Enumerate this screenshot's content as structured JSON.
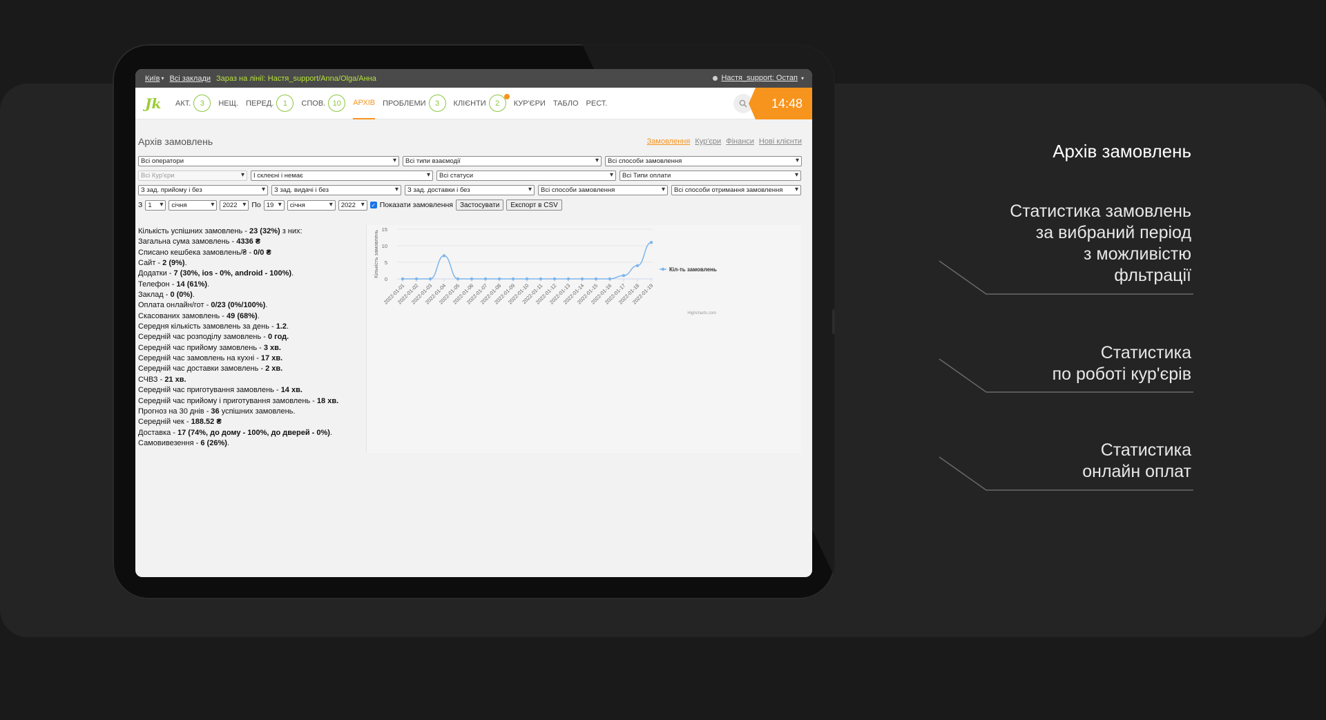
{
  "topbar": {
    "city": "Київ",
    "places": "Всі заклади",
    "online_label": "Зараз на лінії: Настя_support/Anna/Olga/Анна",
    "user": "Настя_support: Остап"
  },
  "nav": {
    "items": [
      {
        "label": "АКТ.",
        "badge": "3"
      },
      {
        "label": "НЕЩ.",
        "badge": ""
      },
      {
        "label": "ПЕРЕД.",
        "badge": "1"
      },
      {
        "label": "СПОВ.",
        "badge": "10"
      },
      {
        "label": "АРХІВ",
        "badge": ""
      },
      {
        "label": "ПРОБЛЕМИ",
        "badge": "3"
      },
      {
        "label": "КЛІЄНТИ",
        "badge": "2"
      },
      {
        "label": "КУР'ЄРИ",
        "badge": ""
      },
      {
        "label": "ТАБЛО",
        "badge": ""
      },
      {
        "label": "РЕСТ.",
        "badge": ""
      }
    ],
    "clock": "14:48",
    "logo": "Jk"
  },
  "page": {
    "title": "Архів замовлень",
    "subnav": [
      "Замовлення",
      "Кур'єри",
      "Фінанси",
      "Нові клієнти"
    ]
  },
  "filters": {
    "row1": [
      "Всі оператори",
      "Всі типи взаємодії",
      "Всі способи замовлення"
    ],
    "row2": [
      "Всі Кур'єри",
      "І склеєні і немає",
      "Всі статуси",
      "Всі Типи оплати"
    ],
    "row3": [
      "З зад. прийому і без",
      "З зад. видачі і без",
      "З зад. доставки і без",
      "Всі способи замовлення",
      "Всі способи отримання замовлення"
    ],
    "from_label": "З",
    "from_day": "1",
    "from_month": "січня",
    "from_year": "2022",
    "to_label": "По",
    "to_day": "19",
    "to_month": "січня",
    "to_year": "2022",
    "show_orders": "Показати замовлення",
    "apply": "Застосувати",
    "export": "Експорт в CSV"
  },
  "stats": [
    {
      "label": "Кількість успішних замовлень - ",
      "value": "23 (32%)",
      "suffix": " з них:"
    },
    {
      "label": "Загальна сума замовлень - ",
      "value": "4336 ₴",
      "suffix": ""
    },
    {
      "label": "Списано кешбека замовлень/₴ - ",
      "value": "0/0 ₴",
      "suffix": ""
    },
    {
      "label": "Сайт - ",
      "value": "2 (9%)",
      "suffix": "."
    },
    {
      "label": "Додатки - ",
      "value": "7 (30%, ios - 0%, android - 100%)",
      "suffix": "."
    },
    {
      "label": "Телефон - ",
      "value": "14 (61%)",
      "suffix": "."
    },
    {
      "label": "Заклад - ",
      "value": "0 (0%)",
      "suffix": "."
    },
    {
      "label": "Оплата онлайн/гот - ",
      "value": "0/23 (0%/100%)",
      "suffix": "."
    },
    {
      "label": "Скасованих замовлень - ",
      "value": "49 (68%)",
      "suffix": "."
    },
    {
      "label": "Середня кількість замовлень за день - ",
      "value": "1.2",
      "suffix": "."
    },
    {
      "label": "Середній час розподілу замовлень - ",
      "value": "0 год.",
      "suffix": ""
    },
    {
      "label": "Середній час прийому замовлень - ",
      "value": "3 хв.",
      "suffix": ""
    },
    {
      "label": "Середній час замовлень на кухні - ",
      "value": "17 хв.",
      "suffix": ""
    },
    {
      "label": "Середній час доставки замовлень - ",
      "value": "2 хв.",
      "suffix": ""
    },
    {
      "label": "СЧВЗ - ",
      "value": "21 хв.",
      "suffix": ""
    },
    {
      "label": "Середній час приготування замовлень - ",
      "value": "14 хв.",
      "suffix": ""
    },
    {
      "label": "Середній час прийому і приготування замовлень - ",
      "value": "18 хв.",
      "suffix": ""
    },
    {
      "label": "Прогноз на 30 днів - ",
      "value": "36",
      "suffix": " успішних замовлень."
    },
    {
      "label": "Середній чек - ",
      "value": "188.52 ₴",
      "suffix": ""
    },
    {
      "label": "Доставка - ",
      "value": "17 (74%, до дому - 100%, до дверей - 0%)",
      "suffix": "."
    },
    {
      "label": "Самовивезення - ",
      "value": "6 (26%)",
      "suffix": "."
    }
  ],
  "chart_data": {
    "type": "line",
    "ylabel": "Кількість замовлень",
    "ylim": [
      0,
      15
    ],
    "yticks": [
      0,
      5,
      10,
      15
    ],
    "x": [
      "2022-01-01",
      "2022-01-02",
      "2022-01-03",
      "2022-01-04",
      "2022-01-05",
      "2022-01-06",
      "2022-01-07",
      "2022-01-08",
      "2022-01-09",
      "2022-01-10",
      "2022-01-11",
      "2022-01-12",
      "2022-01-13",
      "2022-01-14",
      "2022-01-15",
      "2022-01-16",
      "2022-01-17",
      "2022-01-18",
      "2022-01-19"
    ],
    "series": [
      {
        "name": "Кіл-ть замовлень",
        "values": [
          0,
          0,
          0,
          7,
          0,
          0,
          0,
          0,
          0,
          0,
          0,
          0,
          0,
          0,
          0,
          0,
          1,
          4,
          11
        ]
      }
    ],
    "color": "#7cb5ec",
    "credit": "Highcharts.com",
    "legend_position": "right"
  },
  "annotations": {
    "title": "Архів замовлень",
    "items": [
      [
        "Статистика замовлень",
        "за вибраний період",
        "з можливістю",
        "фльтрації"
      ],
      [
        "Статистика",
        "по роботі кур'єрів"
      ],
      [
        "Статистика",
        "онлайн оплат"
      ]
    ]
  }
}
